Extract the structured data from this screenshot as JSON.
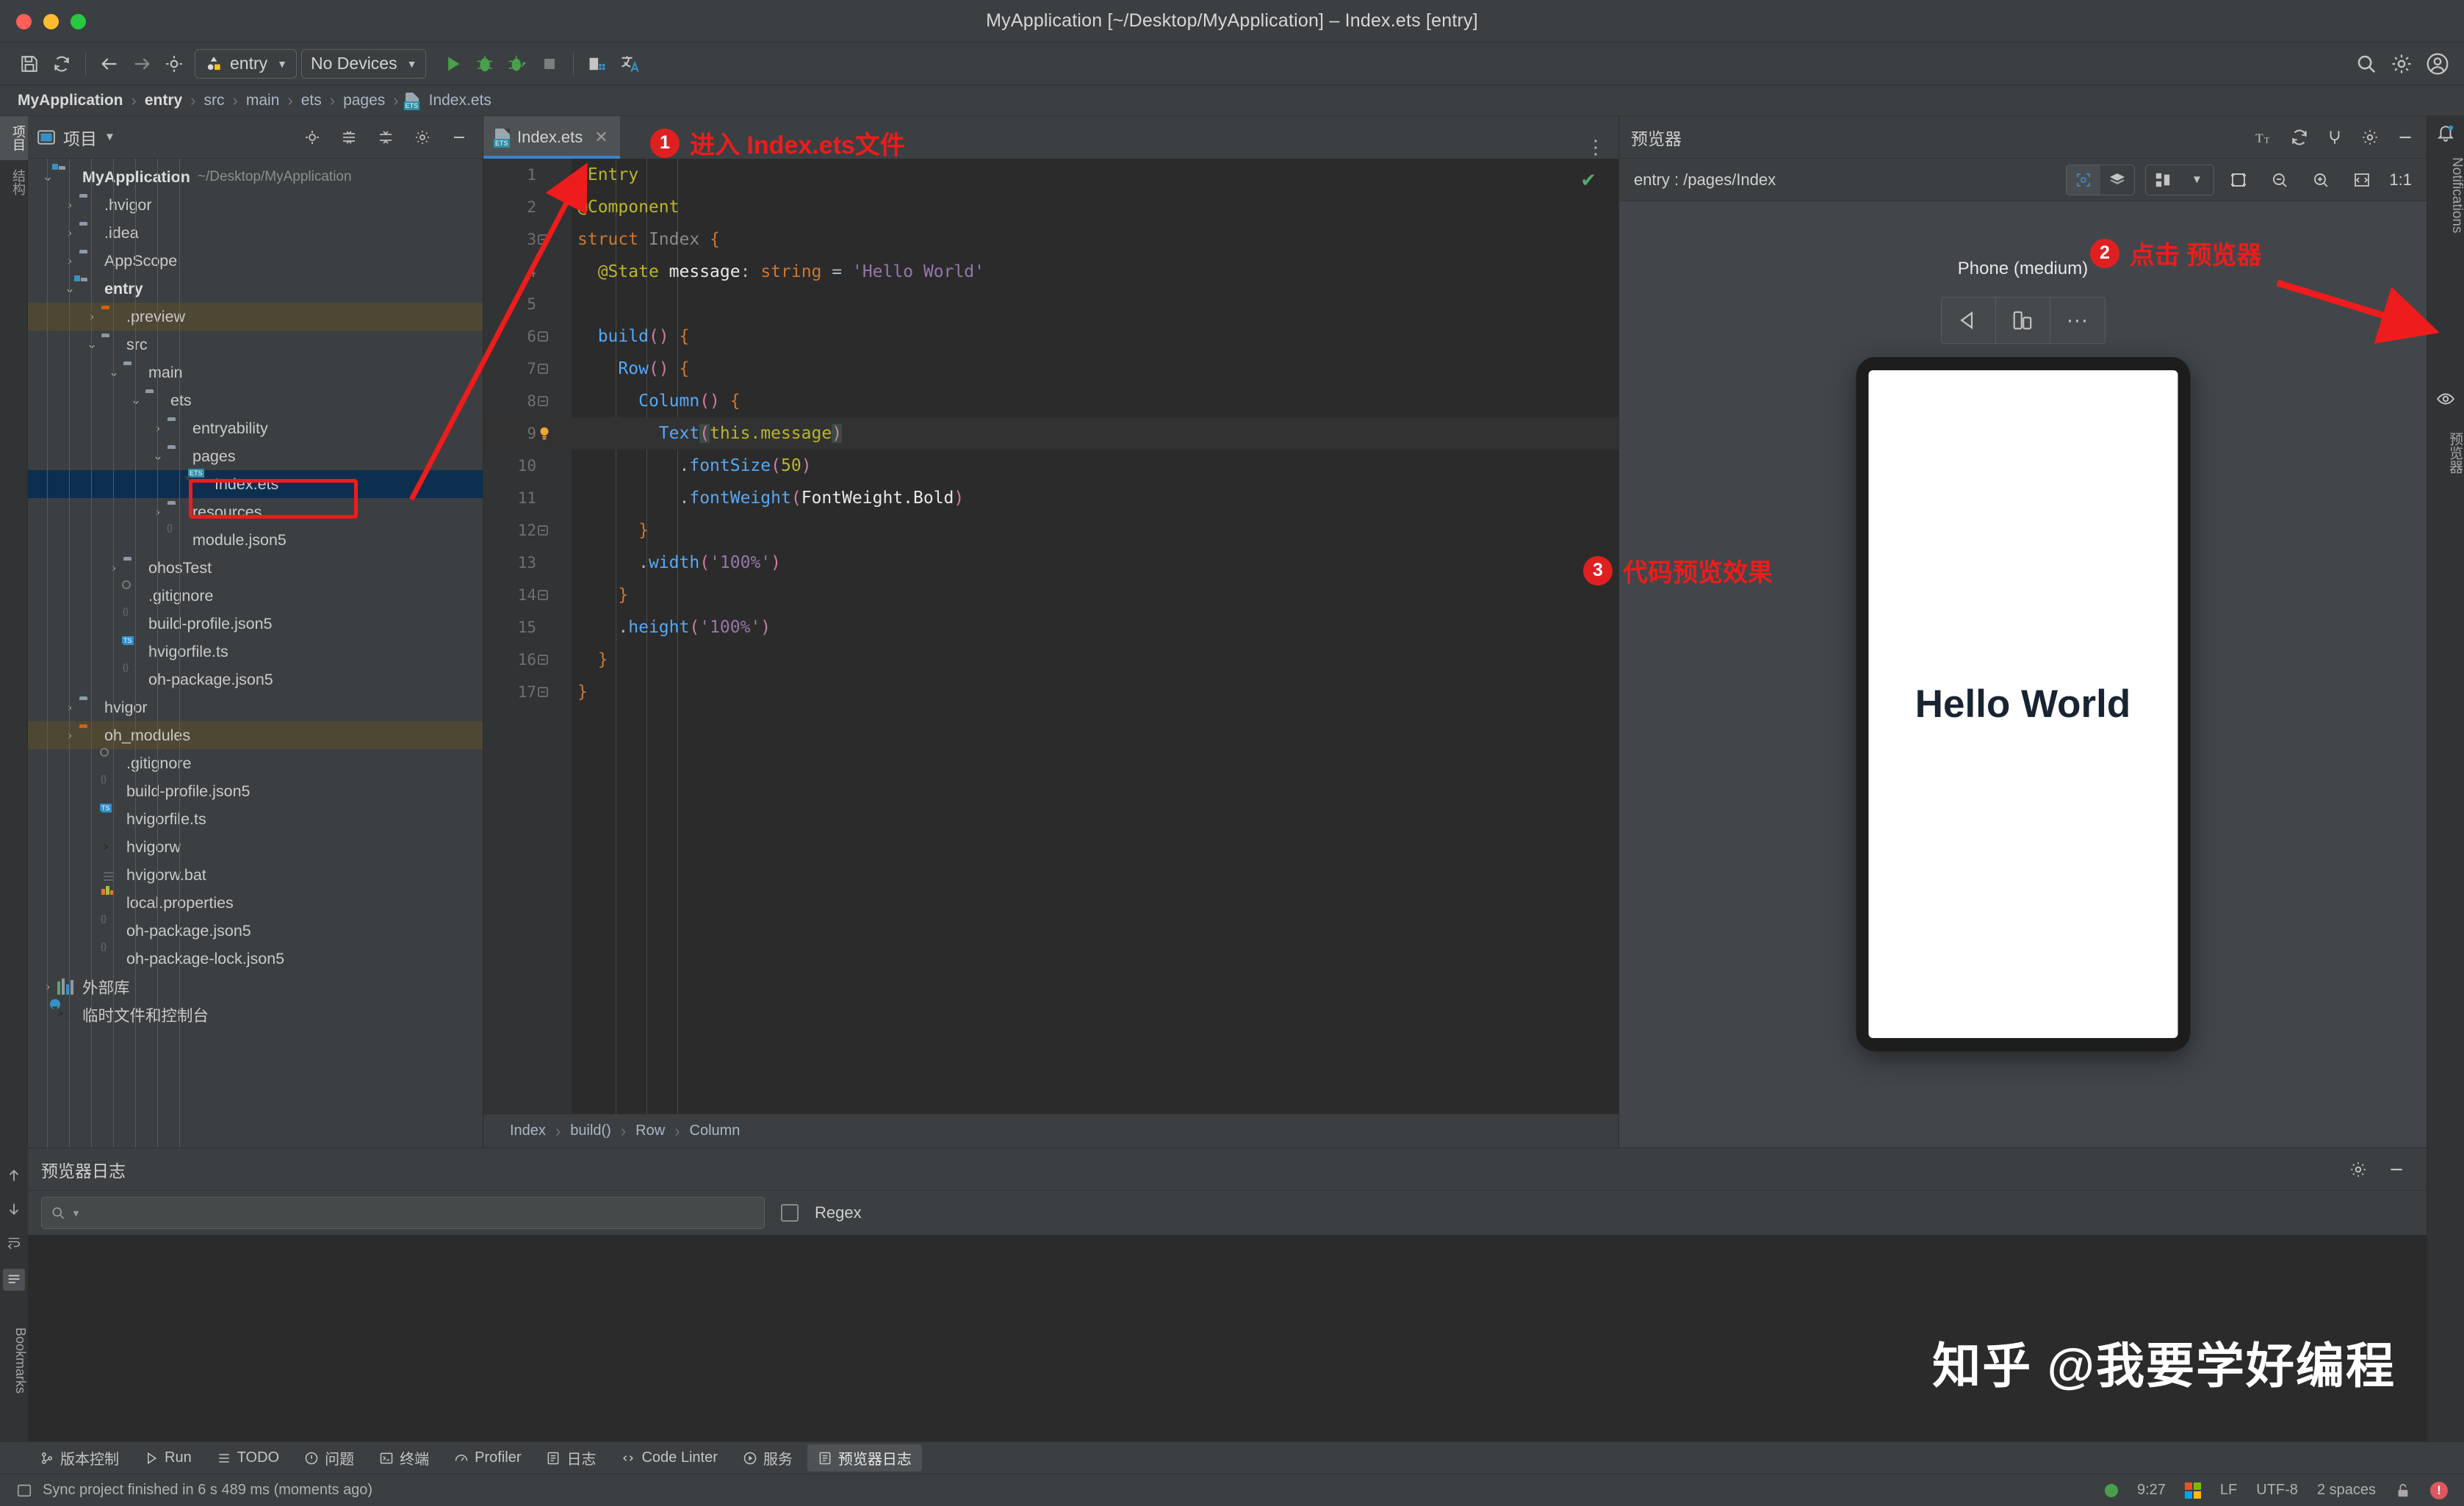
{
  "window": {
    "title": "MyApplication [~/Desktop/MyApplication] – Index.ets [entry]"
  },
  "toolbar": {
    "module_selector": "entry",
    "device_selector": "No Devices",
    "icons": [
      "save-icon",
      "sync-icon",
      "back-arrow-icon",
      "forward-arrow-icon",
      "target-icon",
      "run-icon",
      "debug-icon",
      "debug-attach-icon",
      "stop-icon",
      "device-manager-icon",
      "translate-icon",
      "search-icon",
      "settings-icon",
      "account-icon"
    ]
  },
  "breadcrumb": {
    "items": [
      "MyApplication",
      "entry",
      "src",
      "main",
      "ets",
      "pages",
      "Index.ets"
    ]
  },
  "left_strip": {
    "labels": [
      "项目",
      "结构"
    ]
  },
  "project_panel": {
    "title": "项目",
    "tree": [
      {
        "depth": 0,
        "label": "MyApplication",
        "sub": "~/Desktop/MyApplication",
        "icon": "folder-module",
        "arrow": "down",
        "bold": true,
        "hl": ""
      },
      {
        "depth": 1,
        "label": ".hvigor",
        "sub": "",
        "icon": "folder",
        "arrow": "right",
        "bold": false,
        "hl": ""
      },
      {
        "depth": 1,
        "label": ".idea",
        "sub": "",
        "icon": "folder",
        "arrow": "right",
        "bold": false,
        "hl": ""
      },
      {
        "depth": 1,
        "label": "AppScope",
        "sub": "",
        "icon": "folder",
        "arrow": "right",
        "bold": false,
        "hl": ""
      },
      {
        "depth": 1,
        "label": "entry",
        "sub": "",
        "icon": "folder-module",
        "arrow": "down",
        "bold": true,
        "hl": ""
      },
      {
        "depth": 2,
        "label": ".preview",
        "sub": "",
        "icon": "folder-orange",
        "arrow": "right",
        "bold": false,
        "hl": "brown"
      },
      {
        "depth": 2,
        "label": "src",
        "sub": "",
        "icon": "folder",
        "arrow": "down",
        "bold": false,
        "hl": ""
      },
      {
        "depth": 3,
        "label": "main",
        "sub": "",
        "icon": "folder",
        "arrow": "down",
        "bold": false,
        "hl": ""
      },
      {
        "depth": 4,
        "label": "ets",
        "sub": "",
        "icon": "folder",
        "arrow": "down",
        "bold": false,
        "hl": ""
      },
      {
        "depth": 5,
        "label": "entryability",
        "sub": "",
        "icon": "folder",
        "arrow": "right",
        "bold": false,
        "hl": ""
      },
      {
        "depth": 5,
        "label": "pages",
        "sub": "",
        "icon": "folder",
        "arrow": "down",
        "bold": false,
        "hl": ""
      },
      {
        "depth": 6,
        "label": "Index.ets",
        "sub": "",
        "icon": "file-ets",
        "arrow": "",
        "bold": false,
        "hl": "blue"
      },
      {
        "depth": 5,
        "label": "resources",
        "sub": "",
        "icon": "folder",
        "arrow": "right",
        "bold": false,
        "hl": ""
      },
      {
        "depth": 5,
        "label": "module.json5",
        "sub": "",
        "icon": "file-json",
        "arrow": "",
        "bold": false,
        "hl": ""
      },
      {
        "depth": 3,
        "label": "ohosTest",
        "sub": "",
        "icon": "folder",
        "arrow": "right",
        "bold": false,
        "hl": ""
      },
      {
        "depth": 3,
        "label": ".gitignore",
        "sub": "",
        "icon": "file-git",
        "arrow": "",
        "bold": false,
        "hl": ""
      },
      {
        "depth": 3,
        "label": "build-profile.json5",
        "sub": "",
        "icon": "file-json",
        "arrow": "",
        "bold": false,
        "hl": ""
      },
      {
        "depth": 3,
        "label": "hvigorfile.ts",
        "sub": "",
        "icon": "file-ts",
        "arrow": "",
        "bold": false,
        "hl": ""
      },
      {
        "depth": 3,
        "label": "oh-package.json5",
        "sub": "",
        "icon": "file-json",
        "arrow": "",
        "bold": false,
        "hl": ""
      },
      {
        "depth": 1,
        "label": "hvigor",
        "sub": "",
        "icon": "folder",
        "arrow": "right",
        "bold": false,
        "hl": ""
      },
      {
        "depth": 1,
        "label": "oh_modules",
        "sub": "",
        "icon": "folder-orange",
        "arrow": "right",
        "bold": false,
        "hl": "brown"
      },
      {
        "depth": 2,
        "label": ".gitignore",
        "sub": "",
        "icon": "file-git",
        "arrow": "",
        "bold": false,
        "hl": ""
      },
      {
        "depth": 2,
        "label": "build-profile.json5",
        "sub": "",
        "icon": "file-json",
        "arrow": "",
        "bold": false,
        "hl": ""
      },
      {
        "depth": 2,
        "label": "hvigorfile.ts",
        "sub": "",
        "icon": "file-ts",
        "arrow": "",
        "bold": false,
        "hl": ""
      },
      {
        "depth": 2,
        "label": "hvigorw",
        "sub": "",
        "icon": "file-sh",
        "arrow": "",
        "bold": false,
        "hl": ""
      },
      {
        "depth": 2,
        "label": "hvigorw.bat",
        "sub": "",
        "icon": "file-bat",
        "arrow": "",
        "bold": false,
        "hl": ""
      },
      {
        "depth": 2,
        "label": "local.properties",
        "sub": "",
        "icon": "file-props",
        "arrow": "",
        "bold": false,
        "hl": ""
      },
      {
        "depth": 2,
        "label": "oh-package.json5",
        "sub": "",
        "icon": "file-json",
        "arrow": "",
        "bold": false,
        "hl": ""
      },
      {
        "depth": 2,
        "label": "oh-package-lock.json5",
        "sub": "",
        "icon": "file-json",
        "arrow": "",
        "bold": false,
        "hl": ""
      },
      {
        "depth": 0,
        "label": "外部库",
        "sub": "",
        "icon": "library",
        "arrow": "right",
        "bold": false,
        "hl": ""
      },
      {
        "depth": 0,
        "label": "临时文件和控制台",
        "sub": "",
        "icon": "console",
        "arrow": "",
        "bold": false,
        "hl": ""
      }
    ]
  },
  "editor": {
    "tab_label": "Index.ets",
    "close_label": "✕",
    "lines": [
      {
        "n": "1",
        "fold": "",
        "html": "<span class='deco'>@Entry</span>"
      },
      {
        "n": "2",
        "fold": "",
        "html": "<span class='deco'>@Component</span>"
      },
      {
        "n": "3",
        "fold": "minus",
        "html": "<span class='kw'>struct</span> <span class='type'>Index</span> <span class='br'>{</span>"
      },
      {
        "n": "4",
        "fold": "",
        "html": "  <span class='deco'>@State</span> <span class='wht'>message</span><span class='ident'>:</span> <span class='kw'>string</span> <span class='ident'>=</span> <span class='strv'>'Hello World'</span>"
      },
      {
        "n": "5",
        "fold": "",
        "html": ""
      },
      {
        "n": "6",
        "fold": "minus",
        "html": "  <span class='fn'>build</span><span class='par'>()</span> <span class='br'>{</span>"
      },
      {
        "n": "7",
        "fold": "minus",
        "html": "    <span class='fn'>Row</span><span class='par'>()</span> <span class='br'>{</span>"
      },
      {
        "n": "8",
        "fold": "minus",
        "html": "      <span class='fn'>Column</span><span class='par'>()</span> <span class='br'>{</span>"
      },
      {
        "n": "9",
        "fold": "bulb",
        "html": "        <span class='fn'>Text</span><span class='hlsel'><span class='par'>(</span></span><span class='num'>this.message</span><span class='hlsel'><span class='par'>)</span></span>"
      },
      {
        "n": "10",
        "fold": "",
        "html": "          <span class='ident'>.</span><span class='fn'>fontSize</span><span class='par'>(</span><span class='num'>50</span><span class='par'>)</span>"
      },
      {
        "n": "11",
        "fold": "",
        "html": "          <span class='ident'>.</span><span class='fn'>fontWeight</span><span class='par'>(</span><span class='wht'>FontWeight.Bold</span><span class='par'>)</span>"
      },
      {
        "n": "12",
        "fold": "minus",
        "html": "      <span class='br'>}</span>"
      },
      {
        "n": "13",
        "fold": "",
        "html": "      <span class='ident'>.</span><span class='fn'>width</span><span class='par'>(</span><span class='strv'>'100%'</span><span class='par'>)</span>"
      },
      {
        "n": "14",
        "fold": "minus",
        "html": "    <span class='br'>}</span>"
      },
      {
        "n": "15",
        "fold": "",
        "html": "    <span class='ident'>.</span><span class='fn'>height</span><span class='par'>(</span><span class='strv'>'100%'</span><span class='par'>)</span>"
      },
      {
        "n": "16",
        "fold": "minus",
        "html": "  <span class='br'>}</span>"
      },
      {
        "n": "17",
        "fold": "minus",
        "html": "<span class='br'>}</span>"
      }
    ],
    "structure_breadcrumb": [
      "Index",
      "build()",
      "Row",
      "Column"
    ]
  },
  "previewer": {
    "title": "预览器",
    "route": "entry : /pages/Index",
    "device_label": "Phone (medium)",
    "zoom_ratio": "1:1",
    "screen_text": "Hello World",
    "head_icons": [
      "font-size-icon",
      "refresh-icon",
      "plug-icon",
      "settings-icon",
      "minimize-icon"
    ],
    "toolbar_icons": [
      "inspector-icon",
      "layers-icon",
      "grid-icon",
      "chevron-down-icon",
      "crop-icon",
      "zoom-out-icon",
      "zoom-in-icon",
      "fit-screen-icon"
    ],
    "device_tools": [
      "rotate-icon",
      "multi-device-icon",
      "more-icon"
    ]
  },
  "right_strip": {
    "notifications": "Notifications",
    "previewer": "预览器"
  },
  "log_panel": {
    "title": "预览器日志",
    "search_placeholder": "",
    "regex_label": "Regex"
  },
  "watermark": {
    "text": "知乎 @我要学好编程"
  },
  "bottom_tools": [
    {
      "label": "版本控制",
      "icon": "vcs-icon",
      "active": false
    },
    {
      "label": "Run",
      "icon": "run-icon",
      "active": false
    },
    {
      "label": "TODO",
      "icon": "todo-icon",
      "active": false
    },
    {
      "label": "问题",
      "icon": "problems-icon",
      "active": false
    },
    {
      "label": "终端",
      "icon": "terminal-icon",
      "active": false
    },
    {
      "label": "Profiler",
      "icon": "profiler-icon",
      "active": false
    },
    {
      "label": "日志",
      "icon": "log-icon",
      "active": false
    },
    {
      "label": "Code Linter",
      "icon": "code-linter-icon",
      "active": false
    },
    {
      "label": "服务",
      "icon": "services-icon",
      "active": false
    },
    {
      "label": "预览器日志",
      "icon": "preview-log-icon",
      "active": true
    }
  ],
  "status_bar": {
    "message": "Sync project finished in 6 s 489 ms (moments ago)",
    "time": "9:27",
    "line_ending": "LF",
    "encoding": "UTF-8",
    "indent": "2 spaces"
  },
  "annotations": [
    {
      "num": "1",
      "text": "进入 Index.ets文件"
    },
    {
      "num": "2",
      "text": "点击 预览器"
    },
    {
      "num": "3",
      "text": "代码预览效果"
    }
  ],
  "colors": {
    "accent_red": "#ee1c1c",
    "tab_underline": "#3b84c9",
    "selection_blue": "#0d2f4f",
    "highlight_brown": "#4e4734"
  }
}
